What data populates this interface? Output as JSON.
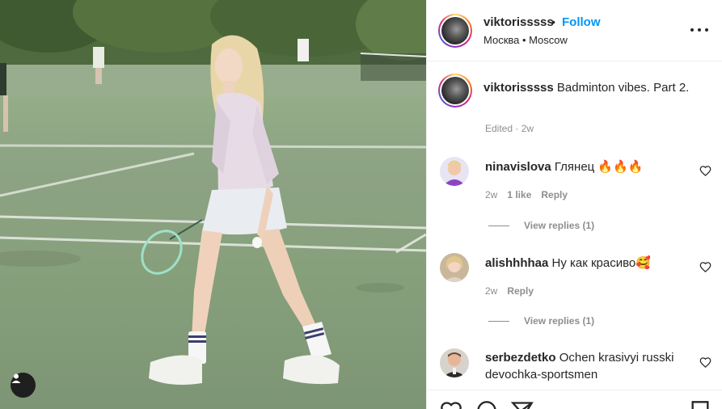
{
  "post": {
    "username": "viktorisssss",
    "separator": "•",
    "follow_label": "Follow",
    "location": "Москва • Moscow",
    "caption_username": "viktorisssss",
    "caption_text": "Badminton vibes. Part 2.",
    "caption_meta": "Edited · 2w"
  },
  "comments": [
    {
      "username": "ninavislova",
      "text": "Глянец 🔥🔥🔥",
      "age": "2w",
      "likes": "1 like",
      "reply_label": "Reply",
      "view_replies": "View replies (1)"
    },
    {
      "username": "alishhhhaa",
      "text": "Ну как красиво🥰",
      "age": "2w",
      "reply_label": "Reply",
      "view_replies": "View replies (1)"
    },
    {
      "username": "serbezdetko",
      "text": "Ochen krasivyi russki devochka-sportsmen"
    }
  ],
  "icons": {
    "more": "more-options-icon",
    "heart": "heart-icon",
    "comment": "comment-icon",
    "share": "share-icon",
    "save": "bookmark-icon",
    "user_tag": "user-tag-icon"
  },
  "colors": {
    "follow": "#0095f6",
    "text": "#262626",
    "meta": "#8e8e8e",
    "border": "#efefef"
  }
}
